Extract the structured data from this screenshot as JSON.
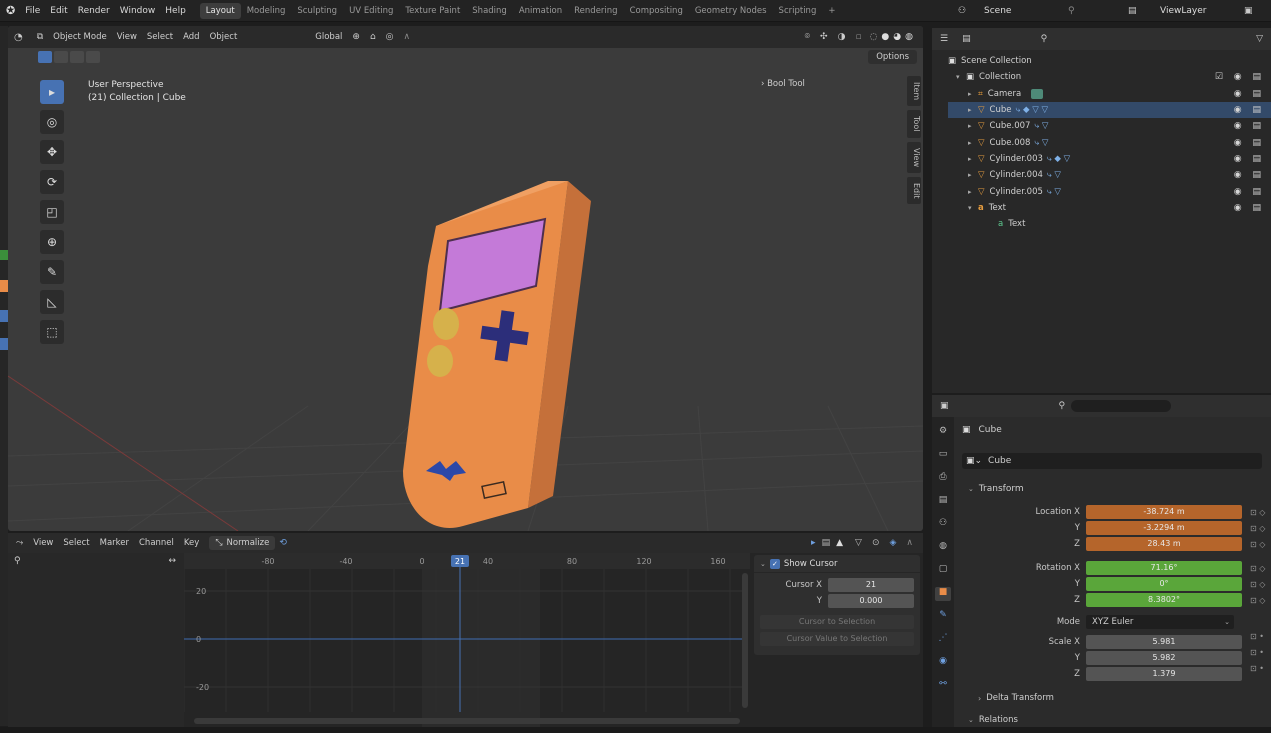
{
  "menu": [
    "File",
    "Edit",
    "Render",
    "Window",
    "Help"
  ],
  "workspaces": [
    {
      "label": "Layout",
      "active": true
    },
    {
      "label": "Modeling"
    },
    {
      "label": "Sculpting"
    },
    {
      "label": "UV Editing"
    },
    {
      "label": "Texture Paint"
    },
    {
      "label": "Shading"
    },
    {
      "label": "Animation"
    },
    {
      "label": "Rendering"
    },
    {
      "label": "Compositing"
    },
    {
      "label": "Geometry Nodes"
    },
    {
      "label": "Scripting"
    }
  ],
  "plus_label": "+",
  "scene": {
    "label": "Scene",
    "viewlayer": "ViewLayer"
  },
  "viewport": {
    "mode": "Object Mode",
    "menus": [
      "View",
      "Select",
      "Add",
      "Object"
    ],
    "orientation": "Global",
    "options_label": "Options",
    "overlay_title": "User Perspective",
    "overlay_sub": "(21) Collection | Cube",
    "bool_tool": "› Bool Tool",
    "side_tabs": [
      "Item",
      "Tool",
      "View",
      "Edit"
    ]
  },
  "outliner": {
    "root": "Scene Collection",
    "collection": "Collection",
    "items": [
      {
        "label": "Camera",
        "type": "camera"
      },
      {
        "label": "Cube",
        "type": "mesh",
        "mods": "⤷ ◆ ▽ ▽"
      },
      {
        "label": "Cube.007",
        "type": "mesh",
        "mods": "⤷ ▽"
      },
      {
        "label": "Cube.008",
        "type": "mesh",
        "mods": "⤷ ▽"
      },
      {
        "label": "Cylinder.003",
        "type": "mesh",
        "mods": "⤷ ◆ ▽"
      },
      {
        "label": "Cylinder.004",
        "type": "mesh",
        "mods": "⤷ ▽"
      },
      {
        "label": "Cylinder.005",
        "type": "mesh",
        "mods": "⤷ ▽"
      },
      {
        "label": "Text",
        "type": "text"
      }
    ],
    "text_child": "Text"
  },
  "properties": {
    "object_name": "Cube",
    "data_name": "Cube",
    "transform_label": "Transform",
    "location": {
      "label": "Location X",
      "x": "-38.724 m",
      "y": "-3.2294 m",
      "z": "28.43 m"
    },
    "rotation": {
      "label": "Rotation X",
      "x": "71.16°",
      "y": "0°",
      "z": "8.3802°"
    },
    "mode_label": "Mode",
    "mode_value": "XYZ Euler",
    "scale": {
      "label": "Scale X",
      "x": "5.981",
      "y": "5.982",
      "z": "1.379"
    },
    "axis_y": "Y",
    "axis_z": "Z",
    "delta_label": "Delta Transform",
    "relations_label": "Relations"
  },
  "graph": {
    "menus": [
      "View",
      "Select",
      "Marker",
      "Channel",
      "Key"
    ],
    "normalize": "Normalize",
    "frame_ticks": [
      "-80",
      "-40",
      "0",
      "21",
      "40",
      "80",
      "120",
      "160"
    ],
    "value_ticks": [
      "20",
      "0",
      "-20"
    ],
    "current_frame": "21",
    "panel": {
      "show_cursor": "Show Cursor",
      "cursor_x_label": "Cursor X",
      "cursor_x": "21",
      "y_label": "Y",
      "cursor_y": "0.000",
      "to_selection": "Cursor to Selection",
      "values_to_selection": "Cursor Value to Selection"
    }
  },
  "colors": {
    "accent": "#4772b3",
    "orange_field": "#b5652b",
    "green_field": "#5aa63a",
    "gameboy_body": "#e98c48",
    "gameboy_screen": "#c47ad8",
    "gameboy_dpad": "#2c2e7a",
    "gameboy_buttons": "#d6b14b"
  }
}
